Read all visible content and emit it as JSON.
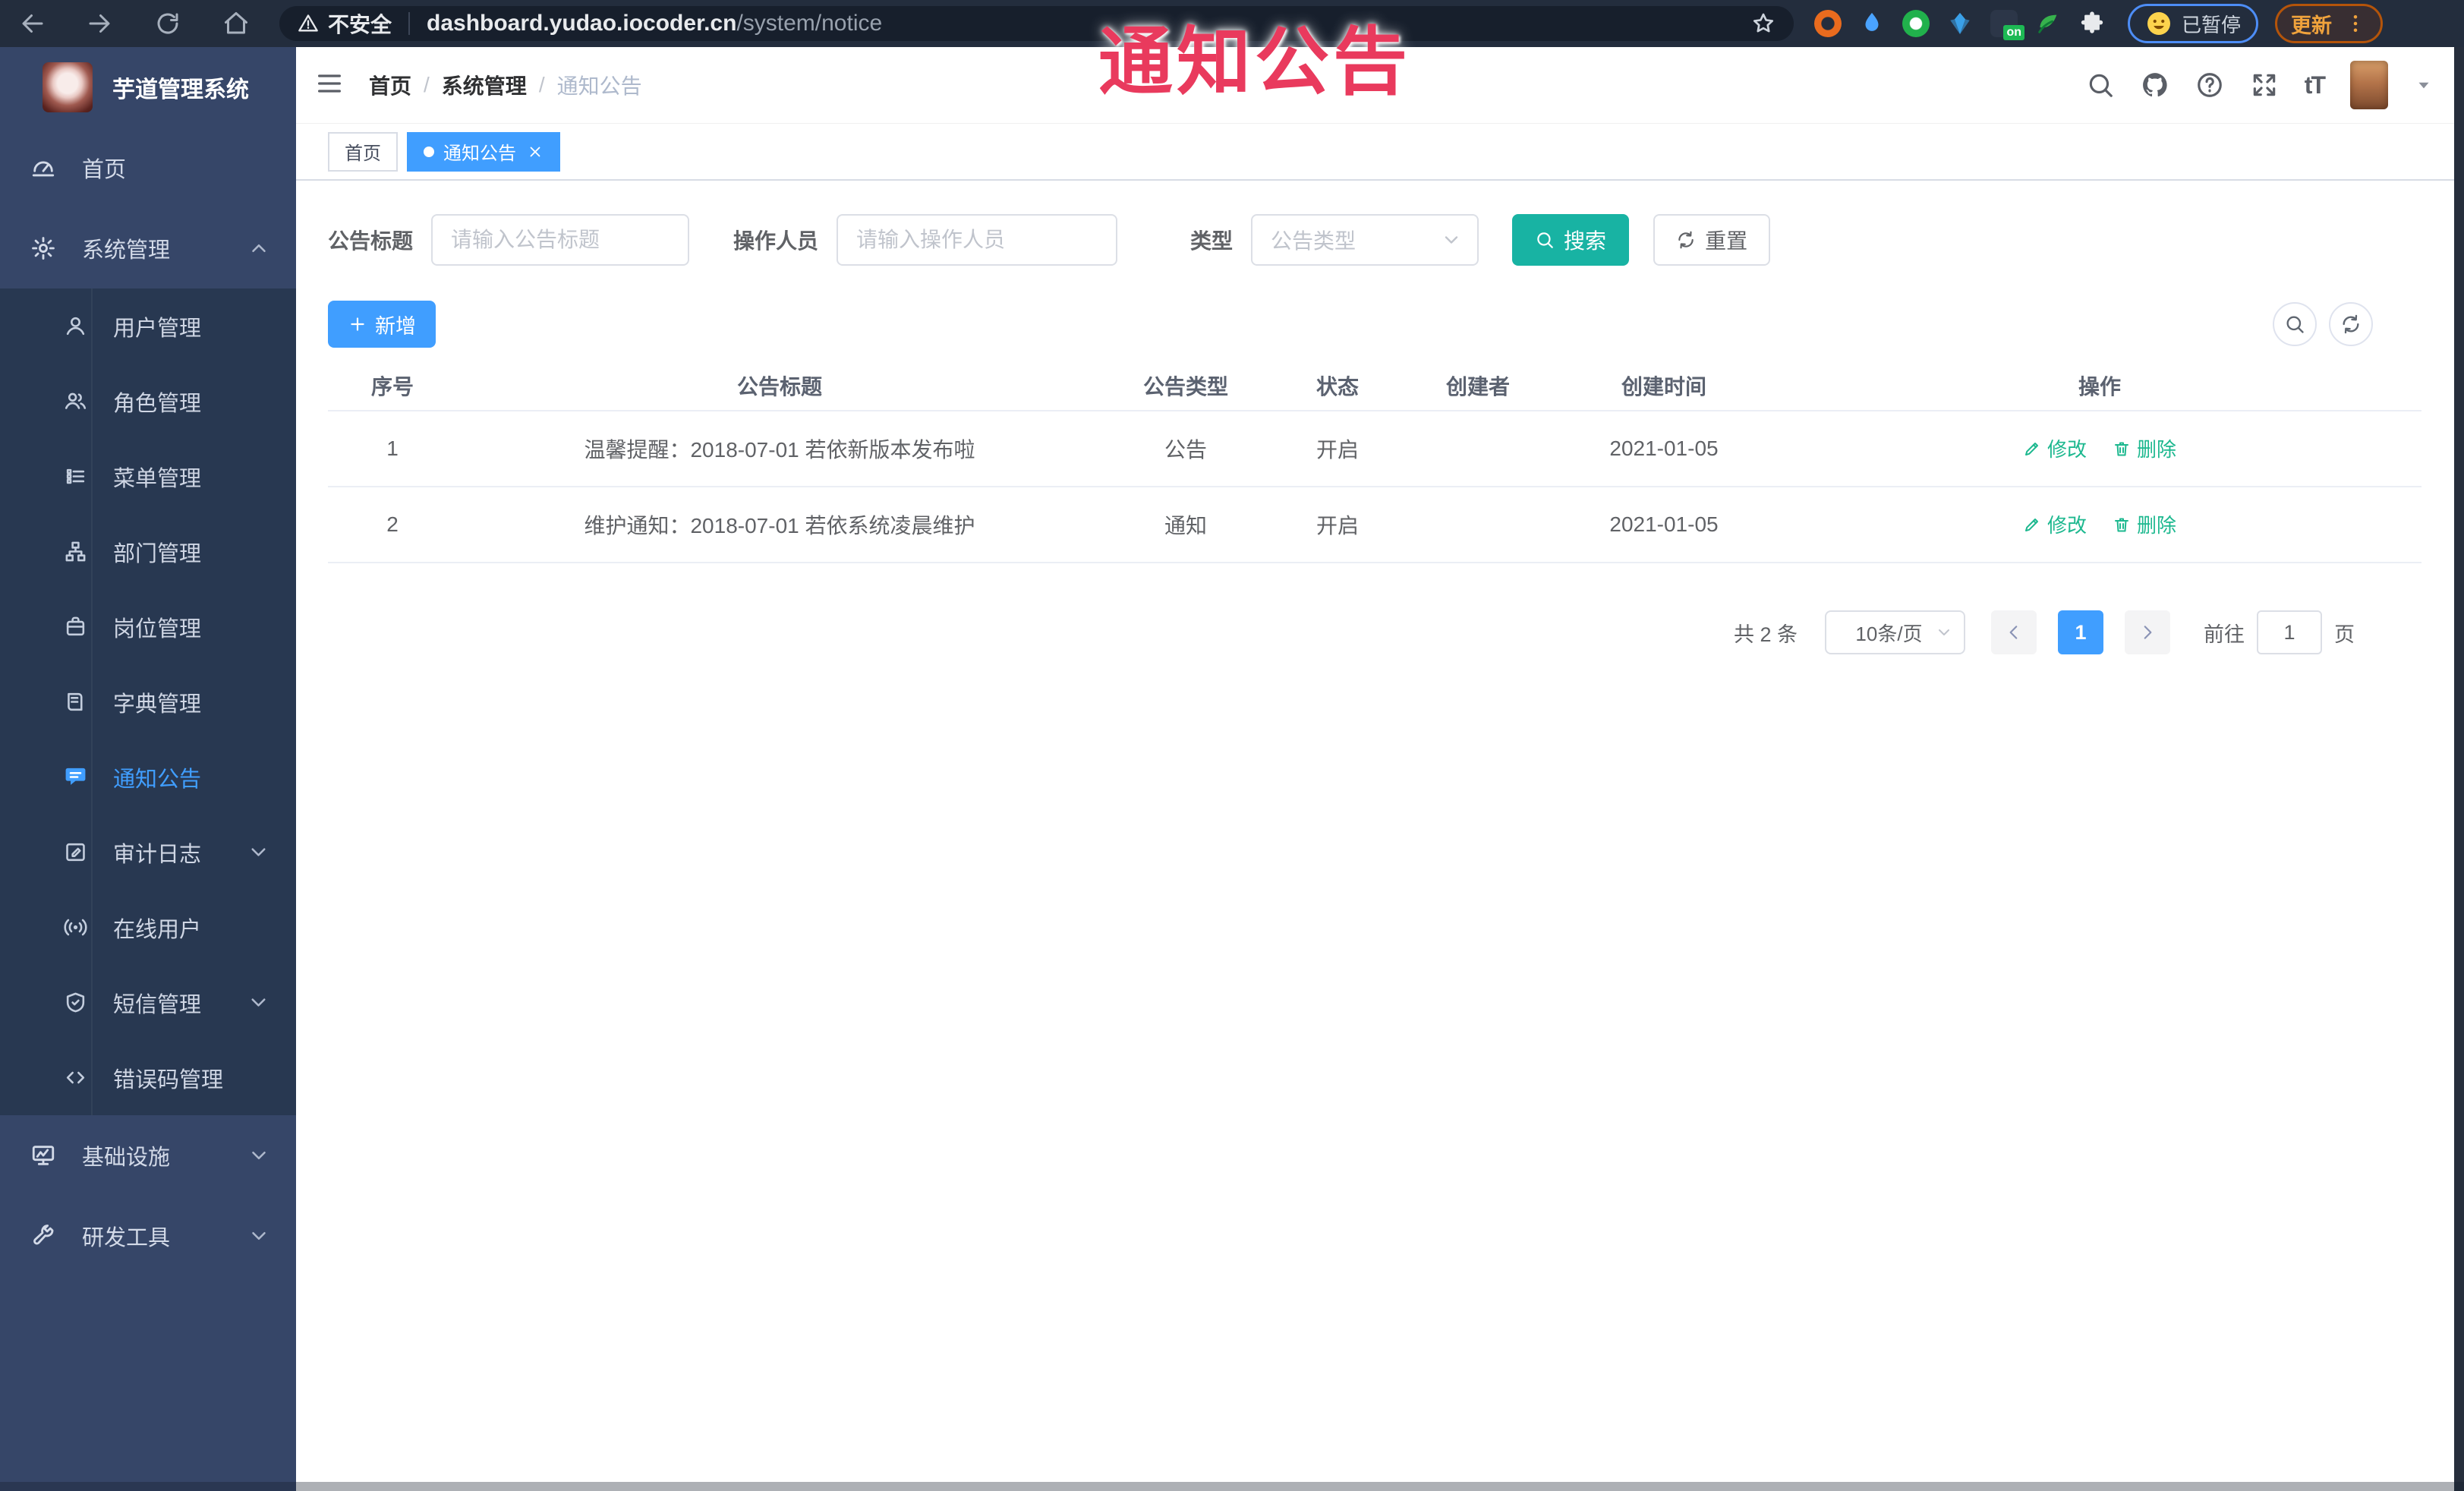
{
  "colors": {
    "primary": "#409eff",
    "teal": "#18b3a3",
    "link_teal": "#1db88f",
    "overlay_red": "#e93a5d",
    "sidebar_bg": "#364668",
    "submenu_bg": "#283851",
    "chrome_bg": "#232d3d",
    "pill_bg": "#171f2c"
  },
  "browser": {
    "security_label": "不安全",
    "url_host": "dashboard.yudao.iocoder.cn",
    "url_path": "/system/notice",
    "ext_on_badge": "on",
    "paused_badge": "已暂停",
    "update_button": "更新"
  },
  "overlay_title": "通知公告",
  "sidebar": {
    "app_title": "芋道管理系统",
    "items": [
      {
        "label": "首页"
      },
      {
        "label": "系统管理",
        "expanded": true
      },
      {
        "label": "用户管理"
      },
      {
        "label": "角色管理"
      },
      {
        "label": "菜单管理"
      },
      {
        "label": "部门管理"
      },
      {
        "label": "岗位管理"
      },
      {
        "label": "字典管理"
      },
      {
        "label": "通知公告",
        "active": true
      },
      {
        "label": "审计日志"
      },
      {
        "label": "在线用户"
      },
      {
        "label": "短信管理"
      },
      {
        "label": "错误码管理"
      },
      {
        "label": "基础设施"
      },
      {
        "label": "研发工具"
      }
    ]
  },
  "header": {
    "breadcrumb": [
      "首页",
      "系统管理",
      "通知公告"
    ],
    "breadcrumb_sep": "/"
  },
  "tabs": [
    {
      "label": "首页",
      "active": false
    },
    {
      "label": "通知公告",
      "active": true
    }
  ],
  "filters": {
    "title_label": "公告标题",
    "title_placeholder": "请输入公告标题",
    "operator_label": "操作人员",
    "operator_placeholder": "请输入操作人员",
    "type_label": "类型",
    "type_placeholder": "公告类型",
    "search_label": "搜索",
    "reset_label": "重置"
  },
  "toolbar": {
    "add_label": "新增"
  },
  "table": {
    "headers": [
      "序号",
      "公告标题",
      "公告类型",
      "状态",
      "创建者",
      "创建时间",
      "操作"
    ],
    "rows": [
      {
        "no": "1",
        "title": "温馨提醒：2018-07-01 若依新版本发布啦",
        "type": "公告",
        "status": "开启",
        "creator": "",
        "created": "2021-01-05",
        "edit": "修改",
        "delete": "删除"
      },
      {
        "no": "2",
        "title": "维护通知：2018-07-01 若依系统凌晨维护",
        "type": "通知",
        "status": "开启",
        "creator": "",
        "created": "2021-01-05",
        "edit": "修改",
        "delete": "删除"
      }
    ]
  },
  "pagination": {
    "total": "共 2 条",
    "page_size": "10条/页",
    "current": "1",
    "goto_label": "前往",
    "goto_value": "1",
    "unit_label": "页"
  }
}
